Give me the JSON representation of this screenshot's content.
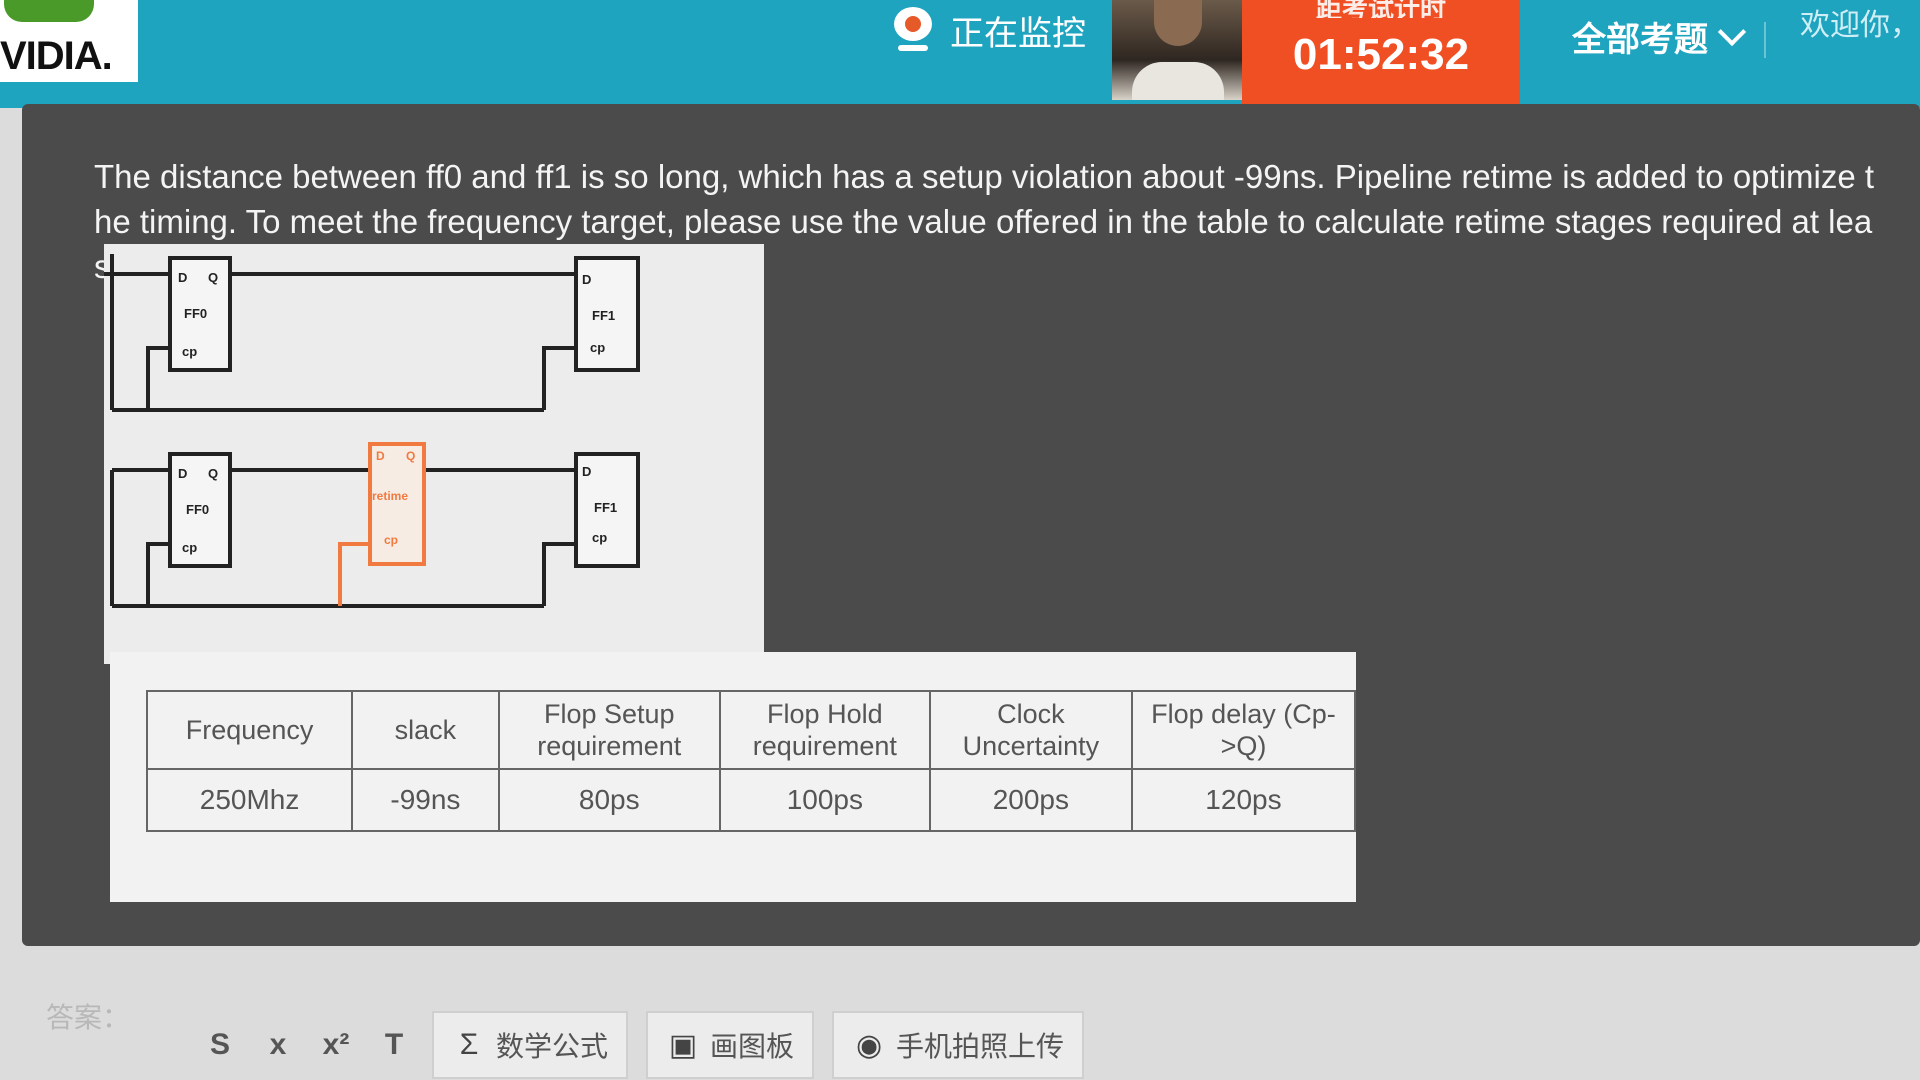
{
  "header": {
    "logo_text": "VIDIA.",
    "monitor_label": "正在监控",
    "timer_label": "距考试计时",
    "timer_value": "01:52:32",
    "all_questions": "全部考题",
    "welcome": "欢迎你，吴"
  },
  "question": {
    "text": "The distance between ff0 and ff1 is so long, which has a setup violation about -99ns. Pipeline retime is added to optimize the timing. To meet the frequency target, please use the value offered in the table to calculate retime stages required at least."
  },
  "diagram": {
    "top": {
      "left_ff": "FF0",
      "right_ff": "FF1",
      "pin_d": "D",
      "pin_q": "Q",
      "pin_cp": "cp"
    },
    "bottom": {
      "left_ff": "FF0",
      "right_ff": "FF1",
      "retime_label": "retime",
      "pin_d": "D",
      "pin_q": "Q",
      "pin_cp": "cp"
    },
    "retime_color": "#f07a40"
  },
  "table": {
    "headers": [
      "Frequency",
      "slack",
      "Flop Setup requirement",
      "Flop Hold requirement",
      "Clock Uncertainty",
      "Flop delay (Cp->Q)"
    ],
    "values": [
      "250Mhz",
      "-99ns",
      "80ps",
      "100ps",
      "200ps",
      "120ps"
    ]
  },
  "editor": {
    "answer_label": "答案：",
    "format_buttons": [
      "S",
      "x",
      "x²",
      "T"
    ],
    "math_button": "数学公式",
    "draw_button": "画图板",
    "photo_button": "手机拍照上传"
  },
  "colors": {
    "header_bg": "#1fa4c0",
    "timer_bg": "#f04e23",
    "panel_bg": "#4b4b4b"
  }
}
